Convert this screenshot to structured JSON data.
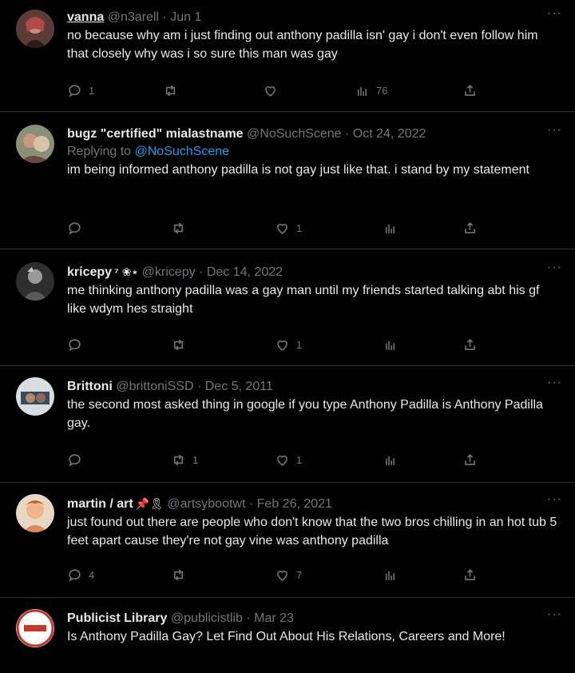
{
  "tweets": [
    {
      "name": "vanna",
      "handle": "@n3arell",
      "date": "Jun 1",
      "emoji": "",
      "replying_label": "",
      "replying_to": "",
      "text": "no because why am i just finding out anthony padilla isn' gay i don't even follow him that closely why was i so sure this man was gay",
      "replies": "1",
      "retweets": "",
      "likes": "",
      "views": "76"
    },
    {
      "name": "bugz \"certified\" mialastname",
      "handle": "@NoSuchScene",
      "date": "Oct 24, 2022",
      "emoji": "",
      "replying_label": "Replying to",
      "replying_to": "@NoSuchScene",
      "text": "im being informed anthony padilla is not gay just like that. i stand by my statement",
      "replies": "",
      "retweets": "",
      "likes": "1",
      "views": ""
    },
    {
      "name": "kricepy",
      "handle": "@kricepy",
      "date": "Dec 14, 2022",
      "emoji": "⁷ ❀⋆",
      "replying_label": "",
      "replying_to": "",
      "text": "me thinking anthony padilla was a gay man until my friends started talking abt his gf like wdym hes straight",
      "replies": "",
      "retweets": "",
      "likes": "1",
      "views": ""
    },
    {
      "name": "Brittoni",
      "handle": "@brittoniSSD",
      "date": "Dec 5, 2011",
      "emoji": "",
      "replying_label": "",
      "replying_to": "",
      "text": "the second most asked thing in google if you type Anthony Padilla is Anthony Padilla gay.",
      "replies": "",
      "retweets": "1",
      "likes": "1",
      "views": ""
    },
    {
      "name": "martin / art",
      "handle": "@artsybootwt",
      "date": "Feb 26, 2021",
      "emoji": "📌🎗",
      "replying_label": "",
      "replying_to": "",
      "text": "just found out there are people who don't know that the two bros chilling in an hot tub 5 feet apart cause they're not gay vine was anthony padilla",
      "replies": "4",
      "retweets": "",
      "likes": "7",
      "views": ""
    },
    {
      "name": "Publicist Library",
      "handle": "@publicistlib",
      "date": "Mar 23",
      "emoji": "",
      "replying_label": "",
      "replying_to": "",
      "text": "Is Anthony Padilla Gay? Let Find Out About His Relations, Careers and More!",
      "replies": "",
      "retweets": "",
      "likes": "",
      "views": ""
    }
  ],
  "separator": "·",
  "more_glyph": "···",
  "colors": {
    "background": "#000000",
    "text": "#e7e9ea",
    "muted": "#71767b",
    "link": "#1d9bf0",
    "border": "#2f3336"
  }
}
